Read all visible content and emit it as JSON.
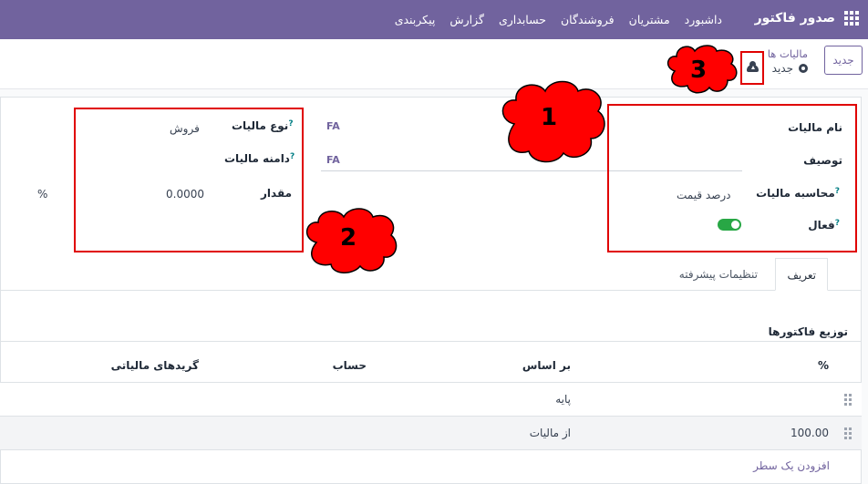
{
  "navbar": {
    "app_name": "صدور فاکتور",
    "menu": [
      "داشبورد",
      "مشتریان",
      "فروشندگان",
      "حسابداری",
      "گزارش",
      "پیکربندی"
    ]
  },
  "control_panel": {
    "new_button": "جدید",
    "breadcrumb_parent": "مالیات ها",
    "breadcrumb_current": "جدید"
  },
  "form": {
    "tax_name_label": "نام مالیات",
    "tax_name_value": "FA",
    "description_label": "توصیف",
    "description_value": "FA",
    "tax_computation_label": "محاسبه مالیات",
    "tax_computation_value": "درصد قیمت",
    "active_label": "فعال",
    "active_value": true,
    "tax_type_label": "نوع مالیات",
    "tax_type_value": "فروش",
    "tax_scope_label": "دامنه مالیات",
    "amount_label": "مقدار",
    "amount_value": "0.0000",
    "percent_symbol": "%",
    "help_mark": "?"
  },
  "tabs": {
    "definition": "تعریف",
    "advanced": "تنظیمات پیشرفته"
  },
  "distribution": {
    "title": "توزیع فاکتورها",
    "columns": {
      "percent": "%",
      "based_on": "بر اساس",
      "account": "حساب",
      "tax_grids": "گریدهای مالیاتی"
    },
    "rows": [
      {
        "percent": "",
        "based_on": "پایه"
      },
      {
        "percent": "100.00",
        "based_on": "از مالیات"
      }
    ],
    "add_line": "افزودن یک سطر"
  },
  "annotations": {
    "one": "1",
    "two": "2",
    "three": "3"
  },
  "colors": {
    "brand": "#71639e",
    "toggle_on": "#28a745",
    "annotation_border": "#e00000",
    "annotation_cloud": "#ff0000"
  }
}
